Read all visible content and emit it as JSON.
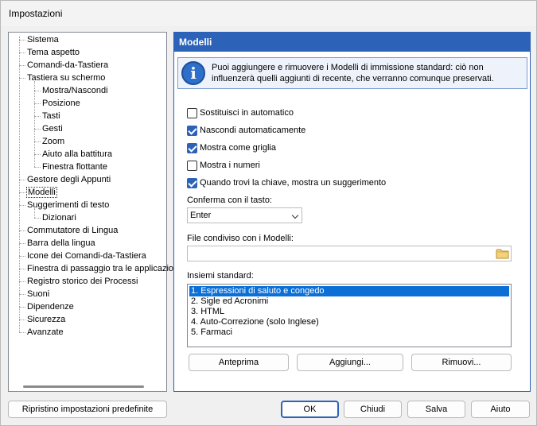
{
  "window": {
    "title": "Impostazioni"
  },
  "tree": {
    "items": [
      {
        "label": "Sistema",
        "level": 0
      },
      {
        "label": "Tema aspetto",
        "level": 0
      },
      {
        "label": "Comandi-da-Tastiera",
        "level": 0
      },
      {
        "label": "Tastiera su schermo",
        "level": 0
      },
      {
        "label": "Mostra/Nascondi",
        "level": 1
      },
      {
        "label": "Posizione",
        "level": 1
      },
      {
        "label": "Tasti",
        "level": 1
      },
      {
        "label": "Gesti",
        "level": 1
      },
      {
        "label": "Zoom",
        "level": 1
      },
      {
        "label": "Aiuto alla battitura",
        "level": 1
      },
      {
        "label": "Finestra flottante",
        "level": 1
      },
      {
        "label": "Gestore degli Appunti",
        "level": 0
      },
      {
        "label": "Modelli",
        "level": 0,
        "selected": true
      },
      {
        "label": "Suggerimenti di testo",
        "level": 0
      },
      {
        "label": "Dizionari",
        "level": 1
      },
      {
        "label": "Commutatore di Lingua",
        "level": 0
      },
      {
        "label": "Barra della lingua",
        "level": 0
      },
      {
        "label": "Icone dei Comandi-da-Tastiera",
        "level": 0
      },
      {
        "label": "Finestra di passaggio tra le applicazioni",
        "level": 0
      },
      {
        "label": "Registro storico dei Processi",
        "level": 0
      },
      {
        "label": "Suoni",
        "level": 0
      },
      {
        "label": "Dipendenze",
        "level": 0
      },
      {
        "label": "Sicurezza",
        "level": 0
      },
      {
        "label": "Avanzate",
        "level": 0
      }
    ]
  },
  "panel": {
    "title": "Modelli",
    "info": "Puoi aggiungere e rimuovere i Modelli di immissione standard: ciò non influenzerà quelli aggiunti di recente, che verranno comunque preservati.",
    "checkboxes": [
      {
        "label": "Sostituisci in automatico",
        "checked": false
      },
      {
        "label": "Nascondi automaticamente",
        "checked": true
      },
      {
        "label": "Mostra come griglia",
        "checked": true
      },
      {
        "label": "Mostra i numeri",
        "checked": false
      },
      {
        "label": "Quando trovi la chiave, mostra un suggerimento",
        "checked": true
      }
    ],
    "confirm_label": "Conferma con il tasto:",
    "confirm_value": "Enter",
    "file_label": "File condiviso con i Modelli:",
    "file_value": "",
    "sets_label": "Insiemi standard:",
    "sets": [
      "1. Espressioni di saluto e congedo",
      "2. Sigle ed Acronimi",
      "3. HTML",
      "4. Auto-Correzione (solo Inglese)",
      "5. Farmaci"
    ],
    "selected_set": 0,
    "buttons": {
      "preview": "Anteprima",
      "add": "Aggiungi...",
      "remove": "Rimuovi..."
    }
  },
  "footer": {
    "reset": "Ripristino impostazioni predefinite",
    "ok": "OK",
    "close": "Chiudi",
    "save": "Salva",
    "help": "Aiuto"
  },
  "colors": {
    "accent": "#2c63b8",
    "selection": "#0b6fd6"
  },
  "icons": {
    "info": "info-icon",
    "folder": "folder-icon",
    "dropdown": "chevron-down-icon"
  }
}
